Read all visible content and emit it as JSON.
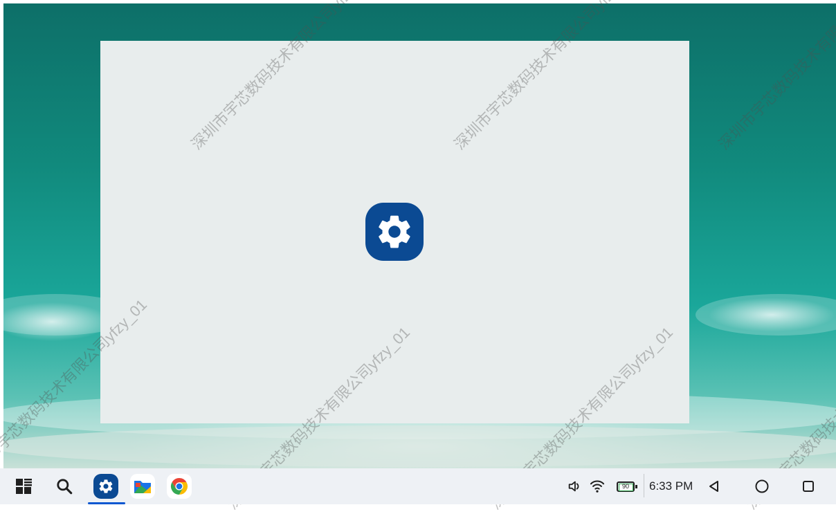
{
  "taskbar": {
    "apps": [
      {
        "name": "App drawer",
        "icon": "app-drawer-icon"
      },
      {
        "name": "Search",
        "icon": "search-icon"
      },
      {
        "name": "Settings",
        "icon": "settings-icon",
        "active": true
      },
      {
        "name": "Files",
        "icon": "files-icon"
      },
      {
        "name": "Chrome",
        "icon": "chrome-icon"
      }
    ],
    "status": {
      "battery": "90",
      "time": "6:33 PM"
    }
  },
  "window": {
    "app_icon": "settings-icon"
  },
  "watermarks": [
    "深圳市宇芯数码技术有限公司yfzy_01"
  ],
  "colors": {
    "settings_blue": "#0b4a93",
    "taskbar_bg": "#eef1f5",
    "window_bg": "#e8eded"
  }
}
